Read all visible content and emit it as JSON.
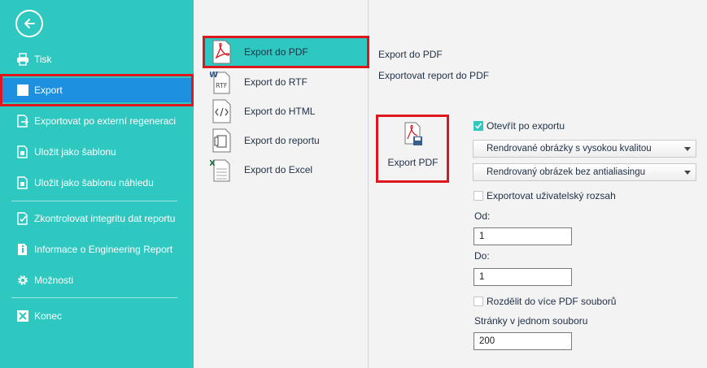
{
  "colors": {
    "sidebar_bg": "#2ec8c0",
    "active_bg": "#1e90e0",
    "highlight": "#e0161e"
  },
  "sidebar": {
    "back_icon": "arrow-left-circle-icon",
    "items": [
      {
        "label": "Tisk",
        "icon": "print-icon"
      },
      {
        "label": "Export",
        "icon": "export-icon",
        "active": true
      },
      {
        "label": "Exportovat po externí regeneraci",
        "icon": "export-regen-icon"
      },
      {
        "label": "Uložit jako šablonu",
        "icon": "template-icon"
      },
      {
        "label": "Uložit jako šablonu náhledu",
        "icon": "preview-template-icon"
      },
      {
        "label": "Zkontrolovat integritu dat reportu",
        "icon": "check-icon"
      },
      {
        "label": "Informace o Engineering Report",
        "icon": "info-icon"
      },
      {
        "label": "Možnosti",
        "icon": "gear-icon"
      },
      {
        "label": "Konec",
        "icon": "close-icon"
      }
    ]
  },
  "export_list": {
    "items": [
      {
        "label": "Export do PDF",
        "icon": "pdf-file-icon",
        "selected": true
      },
      {
        "label": "Export do RTF",
        "icon": "rtf-file-icon"
      },
      {
        "label": "Export do HTML",
        "icon": "html-file-icon"
      },
      {
        "label": "Export do reportu",
        "icon": "report-file-icon"
      },
      {
        "label": "Export do Excel",
        "icon": "excel-file-icon"
      }
    ]
  },
  "panel": {
    "title": "Export do PDF",
    "subtitle": "Exportovat report do PDF",
    "export_button_label": "Export PDF",
    "open_after_export": {
      "label": "Otevřít po exportu",
      "checked": true
    },
    "image_quality": {
      "selected": "Rendrované obrázky s vysokou kvalitou"
    },
    "antialiasing": {
      "selected": "Rendrovaný obrázek bez antialiasingu"
    },
    "custom_range": {
      "label": "Exportovat uživatelský rozsah",
      "checked": false
    },
    "from": {
      "label": "Od:",
      "value": "1"
    },
    "to": {
      "label": "Do:",
      "value": "1"
    },
    "split": {
      "label": "Rozdělit do více PDF souborů",
      "checked": false
    },
    "pages_per_file": {
      "label": "Stránky v jednom souboru",
      "value": "200"
    }
  }
}
